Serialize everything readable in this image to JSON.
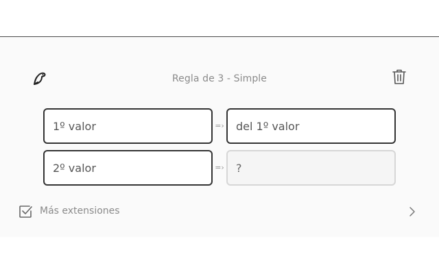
{
  "header": {
    "logo_icon": "bird-icon",
    "title": "Regla de 3 - Simple",
    "delete_icon": "trash-icon"
  },
  "form": {
    "value1_placeholder": "1º valor",
    "value2_placeholder": "2º valor",
    "value1_target_placeholder": "del 1º valor",
    "result_placeholder": "?",
    "arrow_symbol": "=›"
  },
  "footer": {
    "icon": "checkbox-checked-icon",
    "label": "Más extensiones",
    "chevron_icon": "chevron-right-icon"
  },
  "colors": {
    "border_active": "#333333",
    "border_result": "#d6d6d6",
    "panel_bg": "#fafafa",
    "muted_text": "#8a8a8a"
  }
}
